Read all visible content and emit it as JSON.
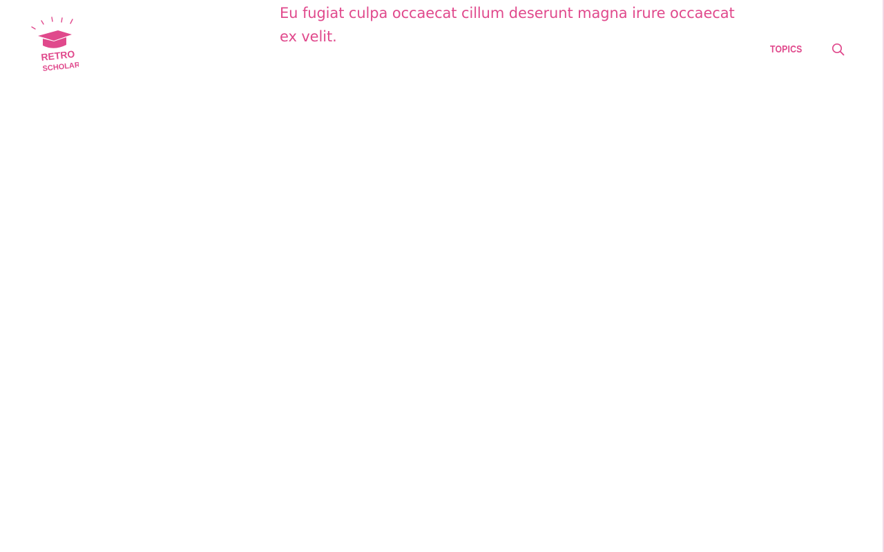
{
  "brand": {
    "logo_line1": "RETRO",
    "logo_line2": "SCHOLAR",
    "icon": "graduation-cap-icon",
    "accent_color": "#e0498c"
  },
  "hero": {
    "text": "Eu fugiat culpa occaecat cillum deserunt magna irure occaecat ex velit."
  },
  "nav": {
    "topics_label": "TOPICS",
    "search_icon": "search-icon"
  }
}
